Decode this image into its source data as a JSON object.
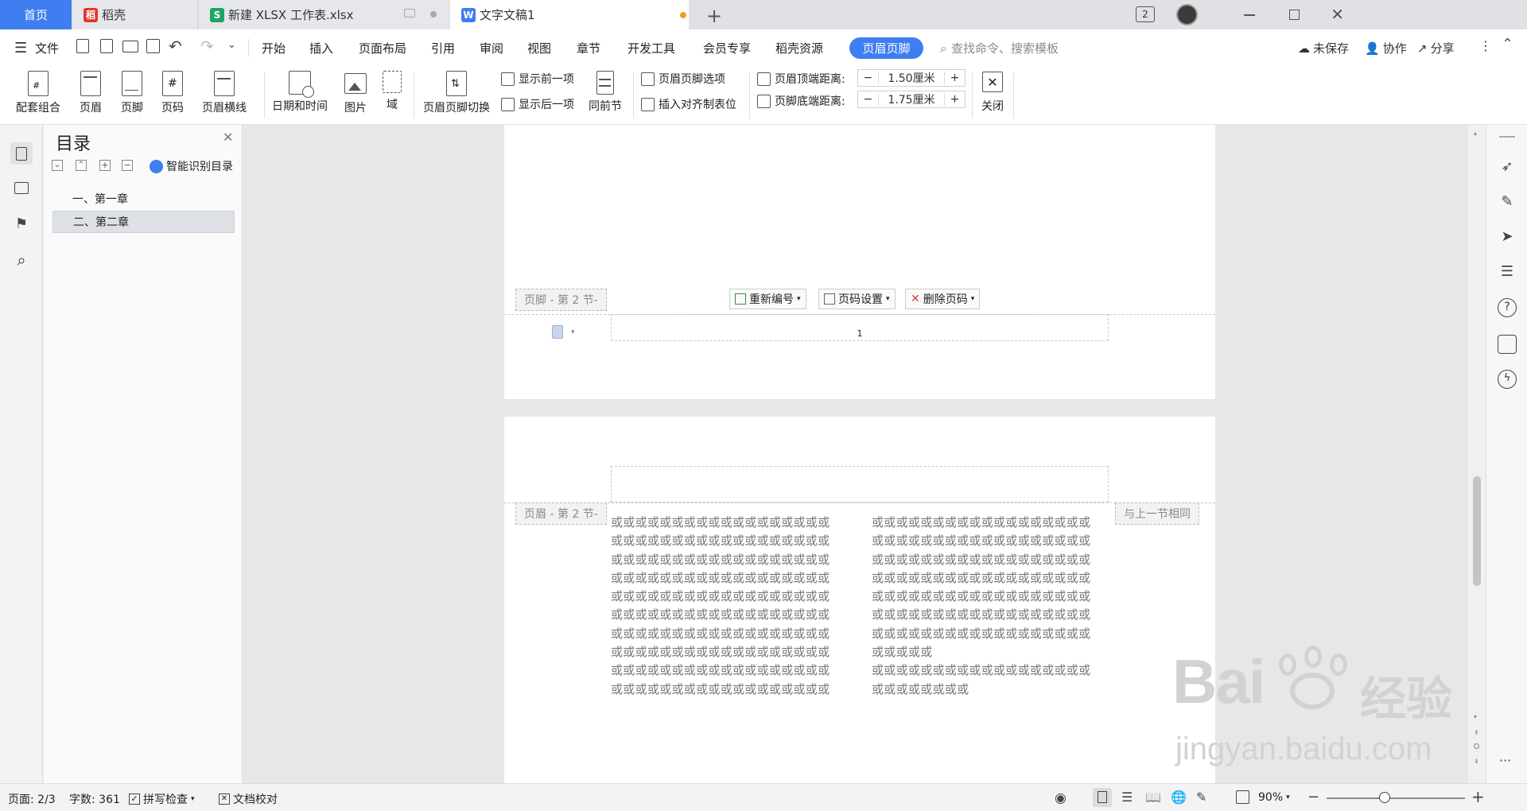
{
  "tabs": {
    "home": "首页",
    "daoke": "稻壳",
    "xlsx": "新建 XLSX 工作表.xlsx",
    "doc": "文字文稿1",
    "add": "+",
    "window_count": "2"
  },
  "menu": {
    "file": "文件",
    "items": [
      "开始",
      "插入",
      "页面布局",
      "引用",
      "审阅",
      "视图",
      "章节",
      "开发工具",
      "会员专享",
      "稻壳资源"
    ],
    "active": "页眉页脚",
    "search_placeholder": "查找命令、搜索模板",
    "unsaved": "未保存",
    "collab": "协作",
    "share": "分享"
  },
  "ribbon": {
    "combo": "配套组合",
    "header": "页眉",
    "footer": "页脚",
    "page_number": "页码",
    "header_line": "页眉横线",
    "date_time": "日期和时间",
    "picture": "图片",
    "field": "域",
    "switch": "页眉页脚切换",
    "show_prev": "显示前一项",
    "show_next": "显示后一项",
    "same_section": "同前节",
    "options": "页眉页脚选项",
    "align_tab": "插入对齐制表位",
    "header_top_label": "页眉顶端距离:",
    "header_top_value": "1.50厘米",
    "footer_bottom_label": "页脚底端距离:",
    "footer_bottom_value": "1.75厘米",
    "minus": "−",
    "plus": "+",
    "close": "关闭"
  },
  "nav": {
    "title": "目录",
    "smart": "智能识别目录",
    "items": [
      "一、第一章",
      "二、第二章"
    ]
  },
  "page1": {
    "footer_label": "页脚 - 第 2 节-",
    "renumber": "重新编号",
    "page_settings": "页码设置",
    "delete_page_number": "删除页码",
    "page_number": "1"
  },
  "page2": {
    "header_label": "页眉 - 第 2 节-",
    "same_as_prev": "与上一节相同",
    "col1": "或或或或或或或或或或或或或或或或或或\n或或或或或或或或或或或或或或或或或或\n或或或或或或或或或或或或或或或或或或\n或或或或或或或或或或或或或或或或或或\n或或或或或或或或或或或或或或或或或或\n或或或或或或或或或或或或或或或或或或\n或或或或或或或或或或或或或或或或或或\n或或或或或或或或或或或或或或或或或或\n或或或或或或或或或或或或或或或或或或\n或或或或或或或或或或或或或或或或或或",
    "col2": "或或或或或或或或或或或或或或或或或或\n或或或或或或或或或或或或或或或或或或\n或或或或或或或或或或或或或或或或或或\n或或或或或或或或或或或或或或或或或或\n或或或或或或或或或或或或或或或或或或\n或或或或或或或或或或或或或或或或或或\n或或或或或或或或或或或或或或或或或或\n或或或或或\n或或或或或或或或或或或或或或或或或或\n或或或或或或或或"
  },
  "status": {
    "page": "页面: 2/3",
    "words": "字数: 361",
    "spell": "拼写检查",
    "proof": "文档校对",
    "zoom": "90%"
  },
  "watermark": {
    "brand": "Bai",
    "brand2": "经验",
    "url": "jingyan.baidu.com"
  },
  "colors": {
    "accent": "#3f7ef0",
    "tab_bar": "#dfe1e5",
    "wps_red": "#e3342f",
    "xlsx_green": "#1fa463",
    "modified_dot": "#f39c1f"
  }
}
